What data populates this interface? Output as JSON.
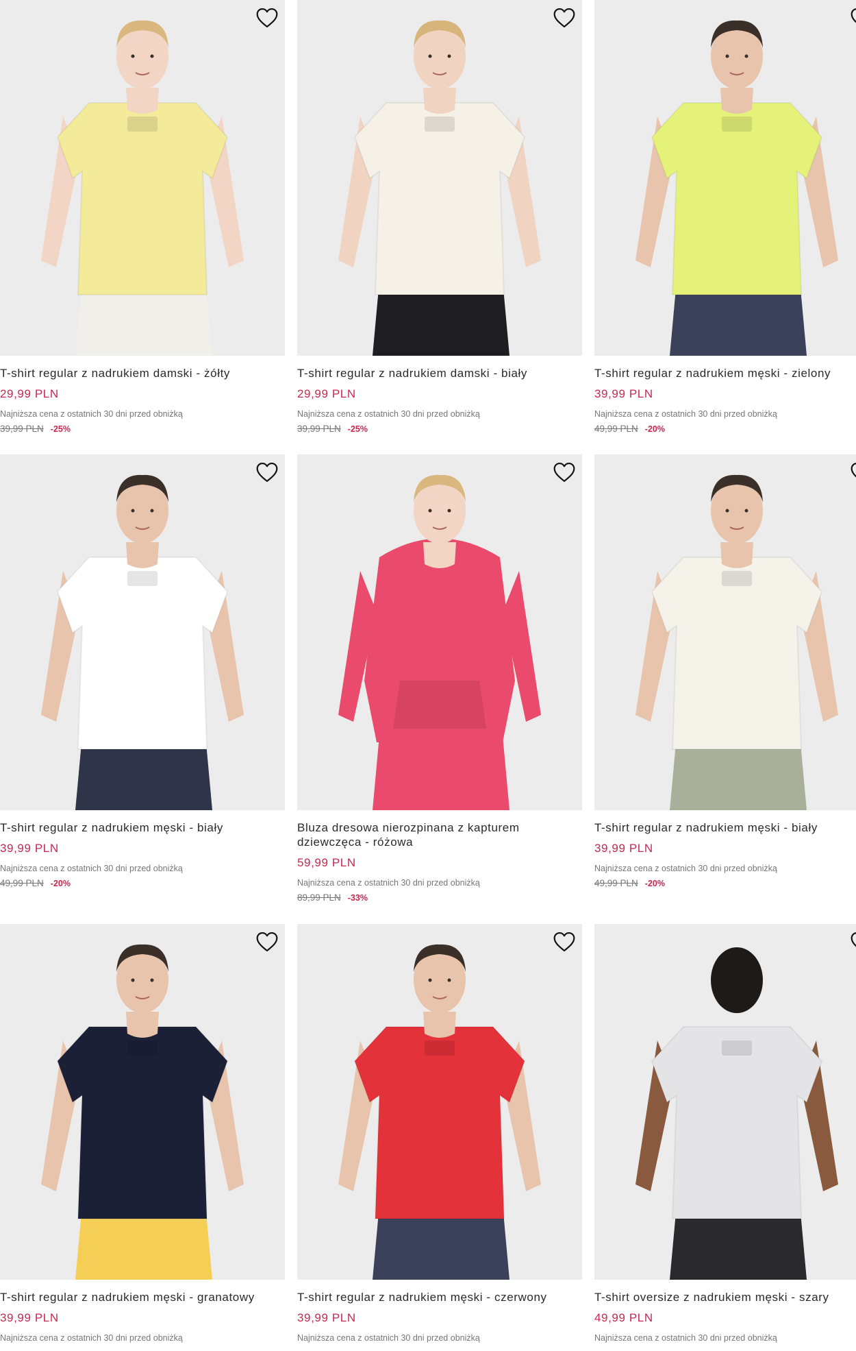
{
  "products": [
    {
      "name": "T-shirt regular z nadrukiem damski - żółty",
      "price": "29,99 PLN",
      "lowest_label": "Najniższa cena z ostatnich 30 dni przed obniżką",
      "old_price": "39,99 PLN",
      "discount": "-25%",
      "shirt_color": "#f3ea9a",
      "pants_color": "#f1efe9",
      "skin": "#f2d5c4",
      "hair": "#d9b77e"
    },
    {
      "name": "T-shirt regular z nadrukiem damski - biały",
      "price": "29,99 PLN",
      "lowest_label": "Najniższa cena z ostatnich 30 dni przed obniżką",
      "old_price": "39,99 PLN",
      "discount": "-25%",
      "shirt_color": "#f6f1e6",
      "pants_color": "#1e1e22",
      "skin": "#f0d3c1",
      "hair": "#d6b47a"
    },
    {
      "name": "T-shirt regular z nadrukiem męski - zielony",
      "price": "39,99 PLN",
      "lowest_label": "Najniższa cena z ostatnich 30 dni przed obniżką",
      "old_price": "49,99 PLN",
      "discount": "-20%",
      "shirt_color": "#e4f27a",
      "pants_color": "#3a4158",
      "skin": "#e8c4ad",
      "hair": "#3b3029"
    },
    {
      "name": "T-shirt regular z nadrukiem męski - biały",
      "price": "39,99 PLN",
      "lowest_label": "Najniższa cena z ostatnich 30 dni przed obniżką",
      "old_price": "49,99 PLN",
      "discount": "-20%",
      "shirt_color": "#ffffff",
      "pants_color": "#2f3448",
      "skin": "#e8c4ad",
      "hair": "#3b3029"
    },
    {
      "name": "Bluza dresowa nierozpinana z kapturem dziewczęca - różowa",
      "price": "59,99 PLN",
      "lowest_label": "Najniższa cena z ostatnich 30 dni przed obniżką",
      "old_price": "89,99 PLN",
      "discount": "-33%",
      "shirt_color": "#ea4a6b",
      "pants_color": "#ea4a6b",
      "skin": "#f2d5c4",
      "hair": "#d9b77e"
    },
    {
      "name": "T-shirt regular z nadrukiem męski - biały",
      "price": "39,99 PLN",
      "lowest_label": "Najniższa cena z ostatnich 30 dni przed obniżką",
      "old_price": "49,99 PLN",
      "discount": "-20%",
      "shirt_color": "#f5f2ea",
      "pants_color": "#a8b09a",
      "skin": "#e8c4ad",
      "hair": "#3b3029"
    },
    {
      "name": "T-shirt regular z nadrukiem męski - granatowy",
      "price": "39,99 PLN",
      "lowest_label": "Najniższa cena z ostatnich 30 dni przed obniżką",
      "old_price": "",
      "discount": "",
      "shirt_color": "#1c2036",
      "pants_color": "#f5cf55",
      "skin": "#e8c4ad",
      "hair": "#3b3029"
    },
    {
      "name": "T-shirt regular z nadrukiem męski - czerwony",
      "price": "39,99 PLN",
      "lowest_label": "Najniższa cena z ostatnich 30 dni przed obniżką",
      "old_price": "",
      "discount": "",
      "shirt_color": "#e4323a",
      "pants_color": "#3a4158",
      "skin": "#e8c4ad",
      "hair": "#3b3029"
    },
    {
      "name": "T-shirt oversize z nadrukiem męski - szary",
      "price": "49,99 PLN",
      "lowest_label": "Najniższa cena z ostatnich 30 dni przed obniżką",
      "old_price": "",
      "discount": "",
      "shirt_color": "#e4e4e6",
      "pants_color": "#2a2a2e",
      "skin": "#8a5a3e",
      "hair": "#1e1a18"
    }
  ],
  "icons": {
    "favorite": "heart-outline-icon"
  },
  "colors": {
    "price": "#c8274f",
    "muted": "#777777",
    "image_bg": "#ebebeb"
  }
}
